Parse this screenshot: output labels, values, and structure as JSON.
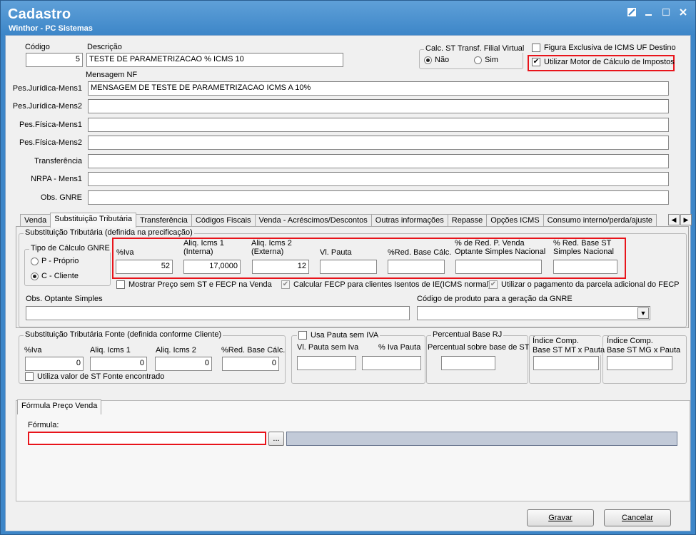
{
  "window": {
    "title": "Cadastro",
    "subtitle": "Winthor - PC Sistemas"
  },
  "header": {
    "codigo_label": "Código",
    "codigo_value": "5",
    "descricao_label": "Descrição",
    "descricao_value": "TESTE DE PARAMETRIZACAO % ICMS 10",
    "calc_st_label": "Calc. ST Transf. Filial Virtual",
    "calc_st_options": [
      "Não",
      "Sim"
    ],
    "calc_st_selected": "Não",
    "figura_exclusiva_label": "Figura Exclusiva de ICMS UF Destino",
    "figura_exclusiva_checked": false,
    "motor_calculo_label": "Utilizar Motor de Cálculo de Impostos",
    "motor_calculo_checked": true
  },
  "mensagem": {
    "section_label": "Mensagem NF",
    "rows": [
      {
        "label": "Pes.Jurídica-Mens1",
        "value": "MENSAGEM DE TESTE DE PARAMETRIZACAO ICMS A 10%"
      },
      {
        "label": "Pes.Jurídica-Mens2",
        "value": ""
      },
      {
        "label": "Pes.Física-Mens1",
        "value": ""
      },
      {
        "label": "Pes.Física-Mens2",
        "value": ""
      },
      {
        "label": "Transferência",
        "value": ""
      },
      {
        "label": "NRPA - Mens1",
        "value": ""
      },
      {
        "label": "Obs. GNRE",
        "value": ""
      }
    ]
  },
  "tabs": [
    {
      "label": "Venda"
    },
    {
      "label": "Substituição Tributária",
      "active": true
    },
    {
      "label": "Transferência"
    },
    {
      "label": "Códigos Fiscais"
    },
    {
      "label": "Venda - Acréscimos/Descontos"
    },
    {
      "label": "Outras informações"
    },
    {
      "label": "Repasse"
    },
    {
      "label": "Opções ICMS"
    },
    {
      "label": "Consumo interno/perda/ajuste"
    }
  ],
  "st": {
    "group_label": "Substituição Tributária (definida na precificação)",
    "tipo_calculo_label": "Tipo de Cálculo GNRE",
    "tipo_calculo_options": [
      "P - Próprio",
      "C - Cliente"
    ],
    "tipo_calculo_selected": "C - Cliente",
    "fields": [
      {
        "label": "%Iva",
        "value": "52"
      },
      {
        "label": "Aliq. Icms 1\n(Interna)",
        "value": "17,0000"
      },
      {
        "label": "Aliq. Icms 2\n(Externa)",
        "value": "12"
      },
      {
        "label": "Vl. Pauta",
        "value": ""
      },
      {
        "label": "%Red. Base Cálc.",
        "value": ""
      },
      {
        "label": "% de Red. P. Venda\nOptante Simples Nacional",
        "value": ""
      },
      {
        "label": "% Red. Base ST\nSimples Nacional",
        "value": ""
      }
    ],
    "mostrar_preco_label": "Mostrar Preço sem ST e FECP na Venda",
    "calcular_fecp_label": "Calcular FECP para clientes Isentos de IE(ICMS normal)",
    "utilizar_pagamento_label": "Utilizar o pagamento da parcela adicional do FECP",
    "obs_optante_label": "Obs. Optante Simples",
    "obs_optante_value": "",
    "codigo_gnre_label": "Código de produto para a geração da GNRE",
    "codigo_gnre_value": ""
  },
  "st_fonte": {
    "group_label": "Substituição Tributária Fonte (definida conforme Cliente)",
    "fields": [
      {
        "label": "%Iva",
        "value": "0"
      },
      {
        "label": "Aliq. Icms 1",
        "value": "0"
      },
      {
        "label": "Aliq. Icms 2",
        "value": "0"
      },
      {
        "label": "%Red. Base Cálc.",
        "value": "0"
      }
    ],
    "utiliza_valor_label": "Utiliza valor de ST Fonte encontrado"
  },
  "pauta": {
    "usa_pauta_label": "Usa Pauta sem IVA",
    "vl_pauta_label": "Vl. Pauta sem Iva",
    "iva_pauta_label": "% Iva Pauta",
    "vl_pauta_value": "",
    "iva_pauta_value": ""
  },
  "percentual_rj": {
    "group_label": "Percentual Base RJ",
    "field_label": "Percentual sobre base de ST",
    "value": ""
  },
  "indice_mt": {
    "label": "Índice Comp.\nBase ST MT x Pauta",
    "value": ""
  },
  "indice_mg": {
    "label": "Índice Comp.\nBase ST MG x Pauta",
    "value": ""
  },
  "formula": {
    "tab_label": "Fórmula Preço Venda",
    "field_label": "Fórmula:",
    "value": "",
    "ellipsis_label": "..."
  },
  "buttons": {
    "gravar": "Gravar",
    "cancelar": "Cancelar"
  }
}
